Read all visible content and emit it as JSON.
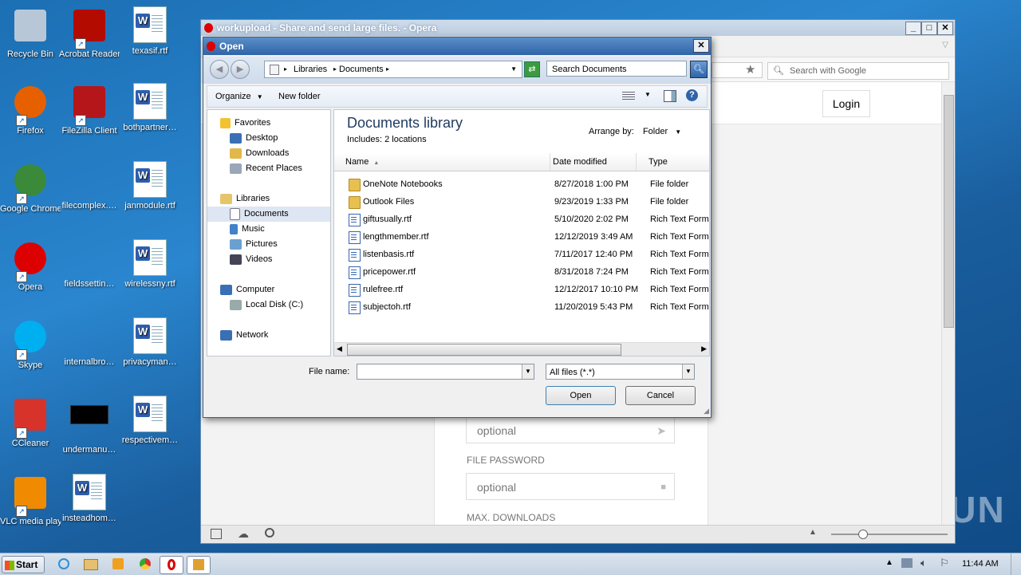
{
  "desktop": {
    "icons": [
      {
        "label": "Recycle Bin"
      },
      {
        "label": "Acrobat Reader DC"
      },
      {
        "label": "texasif.rtf"
      },
      {
        "label": "Firefox"
      },
      {
        "label": "FileZilla Client"
      },
      {
        "label": "bothpartner…"
      },
      {
        "label": "Google Chrome"
      },
      {
        "label": "filecomplex.…"
      },
      {
        "label": "janmodule.rtf"
      },
      {
        "label": "Opera"
      },
      {
        "label": "fieldssettin…"
      },
      {
        "label": "wirelessny.rtf"
      },
      {
        "label": "Skype"
      },
      {
        "label": "internalbro…"
      },
      {
        "label": "privacyman…"
      },
      {
        "label": "CCleaner"
      },
      {
        "label": "undermanu…"
      },
      {
        "label": "respectivem…"
      },
      {
        "label": "VLC media player"
      },
      {
        "label": "insteadhom…"
      }
    ],
    "watermark": "ANY RUN"
  },
  "opera": {
    "title": "workupload - Share and send large files. - Opera",
    "search_placeholder": "Search with Google",
    "login_label": "Login",
    "form": {
      "field1_placeholder": "optional",
      "password_label": "FILE PASSWORD",
      "field2_placeholder": "optional",
      "max_downloads_label": "MAX. DOWNLOADS"
    }
  },
  "dialog": {
    "title": "Open",
    "breadcrumb": [
      "Libraries",
      "Documents"
    ],
    "search_placeholder": "Search Documents",
    "organize_label": "Organize",
    "new_folder_label": "New folder",
    "library_title": "Documents library",
    "includes_text": "Includes:  2 locations",
    "arrange_label": "Arrange by:",
    "arrange_value": "Folder",
    "columns": {
      "name": "Name",
      "date": "Date modified",
      "type": "Type"
    },
    "tree": {
      "favorites": "Favorites",
      "desktop": "Desktop",
      "downloads": "Downloads",
      "recent": "Recent Places",
      "libraries": "Libraries",
      "documents": "Documents",
      "music": "Music",
      "pictures": "Pictures",
      "videos": "Videos",
      "computer": "Computer",
      "localdisk": "Local Disk (C:)",
      "network": "Network"
    },
    "files": [
      {
        "name": "OneNote Notebooks",
        "date": "8/27/2018 1:00 PM",
        "type": "File folder",
        "kind": "folder"
      },
      {
        "name": "Outlook Files",
        "date": "9/23/2019 1:33 PM",
        "type": "File folder",
        "kind": "folder"
      },
      {
        "name": "giftusually.rtf",
        "date": "5/10/2020 2:02 PM",
        "type": "Rich Text Format",
        "kind": "rtf"
      },
      {
        "name": "lengthmember.rtf",
        "date": "12/12/2019 3:49 AM",
        "type": "Rich Text Format",
        "kind": "rtf"
      },
      {
        "name": "listenbasis.rtf",
        "date": "7/11/2017 12:40 PM",
        "type": "Rich Text Format",
        "kind": "rtf"
      },
      {
        "name": "pricepower.rtf",
        "date": "8/31/2018 7:24 PM",
        "type": "Rich Text Format",
        "kind": "rtf"
      },
      {
        "name": "rulefree.rtf",
        "date": "12/12/2017 10:10 PM",
        "type": "Rich Text Format",
        "kind": "rtf"
      },
      {
        "name": "subjectoh.rtf",
        "date": "11/20/2019 5:43 PM",
        "type": "Rich Text Format",
        "kind": "rtf"
      }
    ],
    "filename_label": "File name:",
    "filename_value": "",
    "filter_value": "All files (*.*)",
    "open_label": "Open",
    "cancel_label": "Cancel"
  },
  "taskbar": {
    "start_label": "Start",
    "clock": "11:44 AM"
  }
}
